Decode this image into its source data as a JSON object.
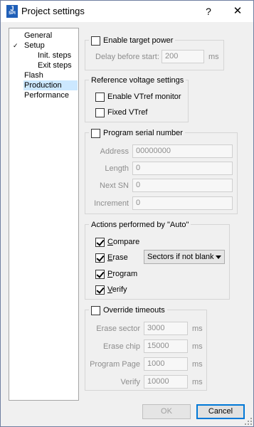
{
  "window": {
    "title": "Project settings",
    "icon_text_top": "J",
    "icon_text_bottom": "SPI",
    "help_label": "?",
    "close_label": "✕"
  },
  "tree": {
    "general": "General",
    "setup": "Setup",
    "init_steps": "Init. steps",
    "exit_steps": "Exit steps",
    "flash": "Flash",
    "production": "Production",
    "performance": "Performance",
    "selected": "Production"
  },
  "target_power": {
    "label": "Enable target power",
    "checked": false,
    "delay_label": "Delay before start:",
    "delay_value": "200",
    "delay_unit": "ms"
  },
  "vref": {
    "title": "Reference voltage settings",
    "monitor_label": "Enable VTref monitor",
    "monitor_checked": false,
    "fixed_label": "Fixed VTref",
    "fixed_checked": false
  },
  "serial": {
    "label": "Program serial number",
    "checked": false,
    "address_label": "Address",
    "address_value": "00000000",
    "length_label": "Length",
    "length_value": "0",
    "next_label": "Next SN",
    "next_value": "0",
    "increment_label": "Increment",
    "increment_value": "0"
  },
  "auto_actions": {
    "title": "Actions performed by \"Auto\"",
    "compare_pre": "",
    "compare_u": "C",
    "compare_post": "ompare",
    "compare_checked": true,
    "erase_pre": "",
    "erase_u": "E",
    "erase_post": "rase",
    "erase_checked": true,
    "erase_mode": "Sectors if not blank",
    "program_pre": "",
    "program_u": "P",
    "program_post": "rogram",
    "program_checked": true,
    "verify_pre": "",
    "verify_u": "V",
    "verify_post": "erify",
    "verify_checked": true
  },
  "timeouts": {
    "label": "Override timeouts",
    "checked": false,
    "erase_sector_label": "Erase sector",
    "erase_sector_value": "3000",
    "erase_chip_label": "Erase chip",
    "erase_chip_value": "15000",
    "program_page_label": "Program Page",
    "program_page_value": "1000",
    "verify_label": "Verify",
    "verify_value": "10000",
    "unit": "ms"
  },
  "buttons": {
    "ok": "OK",
    "cancel": "Cancel"
  }
}
